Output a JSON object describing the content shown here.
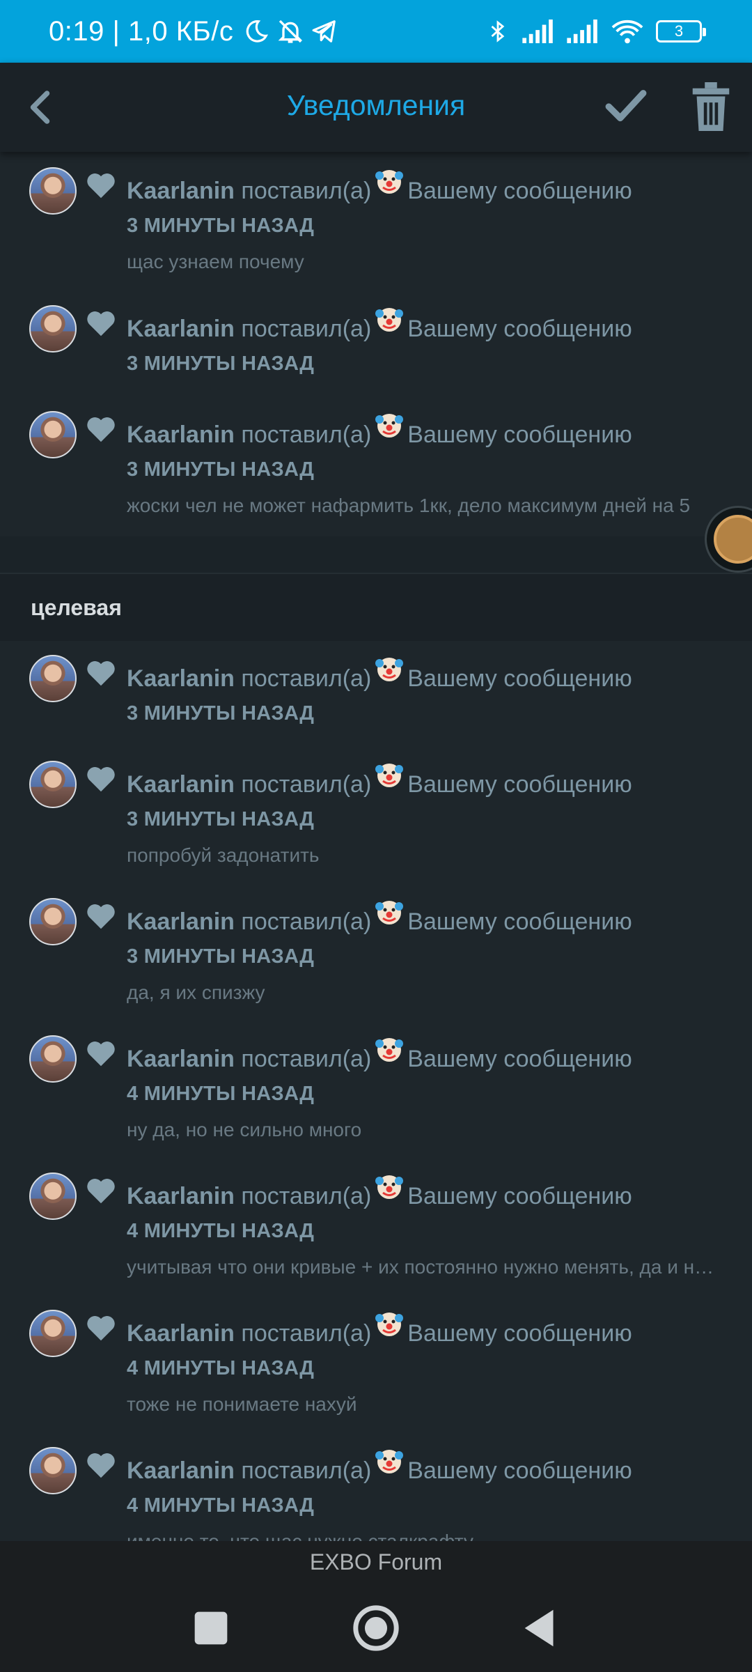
{
  "status_bar": {
    "time": "0:19 | 1,0 КБ/с",
    "battery": "3",
    "icons": [
      "moon-icon",
      "bell-off-icon",
      "telegram-icon",
      "bluetooth-icon",
      "signal-icon",
      "signal-icon",
      "wifi-icon",
      "battery-icon"
    ]
  },
  "app_bar": {
    "title": "Уведомления",
    "accent_color": "#1ea9e6",
    "icons": [
      "back-arrow-icon",
      "check-icon",
      "trash-icon"
    ]
  },
  "notifications_top": [
    {
      "user": "Kaarlanin",
      "action": "поставил(а)",
      "target": "Вашему сообщению",
      "time": "3 МИНУТЫ НАЗАД",
      "excerpt": "щас узнаем почему"
    },
    {
      "user": "Kaarlanin",
      "action": "поставил(а)",
      "target": "Вашему сообщению",
      "time": "3 МИНУТЫ НАЗАД",
      "excerpt": ""
    },
    {
      "user": "Kaarlanin",
      "action": "поставил(а)",
      "target": "Вашему сообщению",
      "time": "3 МИНУТЫ НАЗАД",
      "excerpt": "жоски чел не может нафармить 1кк, дело максимум дней на 5"
    }
  ],
  "section": {
    "label": "целевая"
  },
  "notifications_section": [
    {
      "user": "Kaarlanin",
      "action": "поставил(а)",
      "target": "Вашему сообщению",
      "time": "3 МИНУТЫ НАЗАД",
      "excerpt": ""
    },
    {
      "user": "Kaarlanin",
      "action": "поставил(а)",
      "target": "Вашему сообщению",
      "time": "3 МИНУТЫ НАЗАД",
      "excerpt": "попробуй задонатить"
    },
    {
      "user": "Kaarlanin",
      "action": "поставил(а)",
      "target": "Вашему сообщению",
      "time": "3 МИНУТЫ НАЗАД",
      "excerpt": "да, я их спизжу"
    },
    {
      "user": "Kaarlanin",
      "action": "поставил(а)",
      "target": "Вашему сообщению",
      "time": "4 МИНУТЫ НАЗАД",
      "excerpt": "ну да, но не сильно много"
    },
    {
      "user": "Kaarlanin",
      "action": "поставил(а)",
      "target": "Вашему сообщению",
      "time": "4 МИНУТЫ НАЗАД",
      "excerpt": "учитывая что они кривые + их постоянно нужно менять, да и не дешево"
    },
    {
      "user": "Kaarlanin",
      "action": "поставил(а)",
      "target": "Вашему сообщению",
      "time": "4 МИНУТЫ НАЗАД",
      "excerpt": "тоже не понимаете нахуй"
    },
    {
      "user": "Kaarlanin",
      "action": "поставил(а)",
      "target": "Вашему сообщению",
      "time": "4 МИНУТЫ НАЗАД",
      "excerpt": "именно то, что щас нужно сталкрафту"
    }
  ],
  "footer": {
    "app_name": "EXBO Forum"
  },
  "nav": {
    "icons": [
      "recents-square-icon",
      "home-circle-icon",
      "back-triangle-icon"
    ]
  }
}
